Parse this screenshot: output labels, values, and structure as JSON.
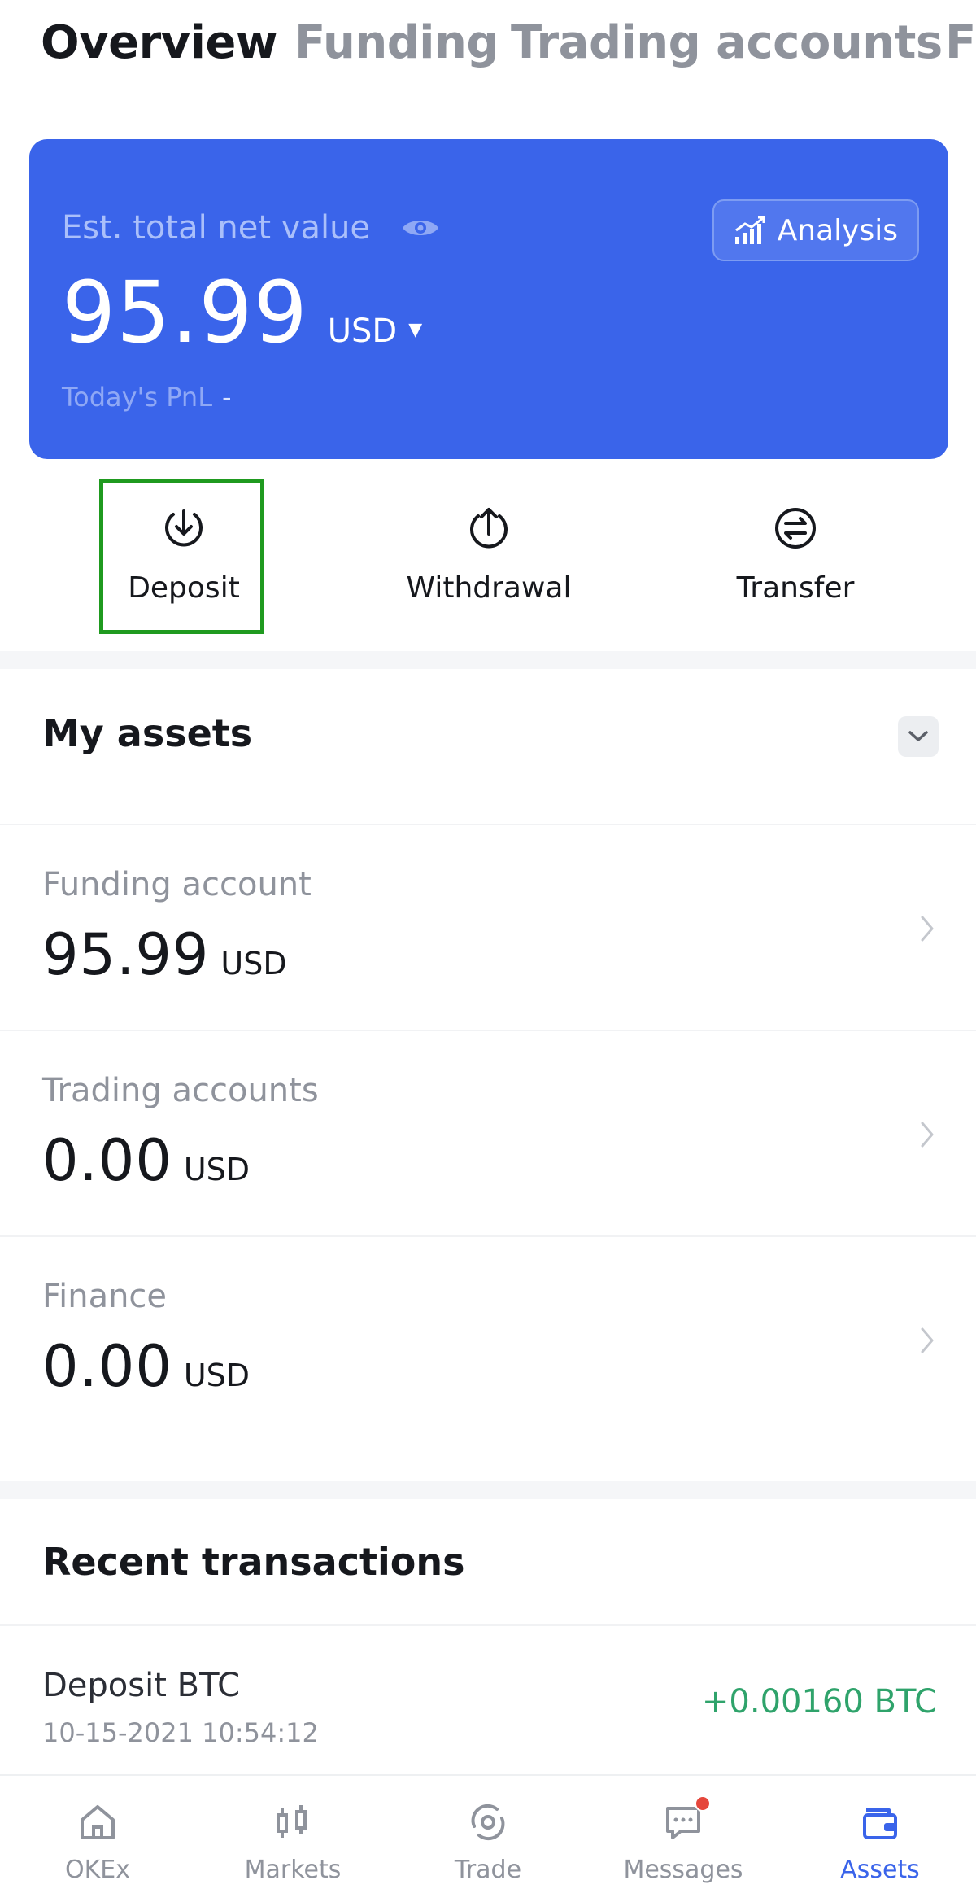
{
  "tabs": [
    {
      "label": "Overview",
      "active": true
    },
    {
      "label": "Funding",
      "active": false
    },
    {
      "label": "Trading accounts",
      "active": false
    },
    {
      "label": "F",
      "active": false
    }
  ],
  "balance_card": {
    "label": "Est. total net value",
    "amount": "95.99",
    "currency": "USD",
    "caret": "▼",
    "pnl_label": "Today's PnL",
    "pnl_value": "-",
    "analysis_label": "Analysis",
    "background_color": "#3a64ea"
  },
  "actions": [
    {
      "label": "Deposit",
      "icon": "download-arrow-icon"
    },
    {
      "label": "Withdrawal",
      "icon": "upload-arrow-icon"
    },
    {
      "label": "Transfer",
      "icon": "transfer-icon"
    }
  ],
  "my_assets": {
    "title": "My assets",
    "rows": [
      {
        "label": "Funding account",
        "value": "95.99",
        "unit": "USD"
      },
      {
        "label": "Trading accounts",
        "value": "0.00",
        "unit": "USD"
      },
      {
        "label": "Finance",
        "value": "0.00",
        "unit": "USD"
      }
    ]
  },
  "recent_transactions": {
    "title": "Recent transactions",
    "items": [
      {
        "title": "Deposit BTC",
        "date": "10-15-2021 10:54:12",
        "amount": "+0.00160 BTC",
        "amount_color": "#2fa36b"
      }
    ]
  },
  "bottom_nav": [
    {
      "label": "OKEx",
      "icon": "home-icon",
      "active": false
    },
    {
      "label": "Markets",
      "icon": "candlestick-icon",
      "active": false
    },
    {
      "label": "Trade",
      "icon": "trade-icon",
      "active": false
    },
    {
      "label": "Messages",
      "icon": "chat-bubble-icon",
      "active": false,
      "has_badge": true
    },
    {
      "label": "Assets",
      "icon": "wallet-icon",
      "active": true
    }
  ],
  "accent_color": "#3a64ea",
  "highlight_color": "#1f9a1f"
}
